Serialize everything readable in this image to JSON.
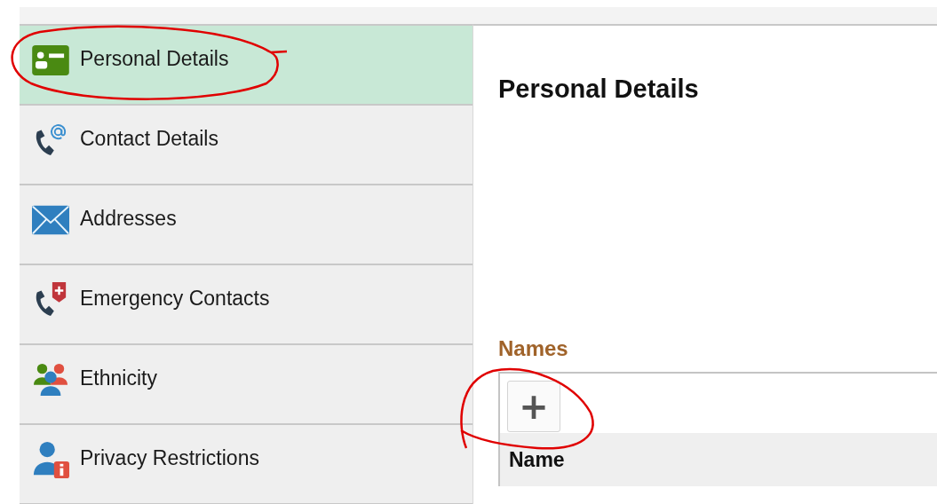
{
  "sidebar": {
    "items": [
      {
        "label": "Personal Details",
        "selected": true
      },
      {
        "label": "Contact Details",
        "selected": false
      },
      {
        "label": "Addresses",
        "selected": false
      },
      {
        "label": "Emergency Contacts",
        "selected": false
      },
      {
        "label": "Ethnicity",
        "selected": false
      },
      {
        "label": "Privacy Restrictions",
        "selected": false
      }
    ]
  },
  "content": {
    "title": "Personal Details",
    "section": {
      "title": "Names",
      "add_button": "+",
      "columns": [
        "Name"
      ]
    }
  }
}
